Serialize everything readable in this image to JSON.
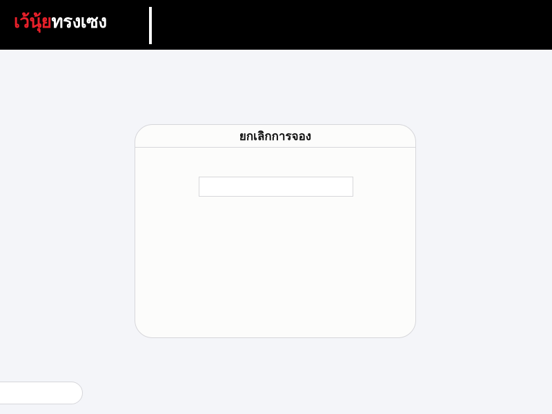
{
  "header": {
    "logo": {
      "red_part": "เว้นุ้ย",
      "white_part": "ทรงเซง"
    }
  },
  "card": {
    "title": "ยกเลิกการจอง",
    "input": {
      "value": "",
      "placeholder": ""
    }
  },
  "colors": {
    "header_bg": "#000000",
    "logo_red": "#e8202a",
    "logo_white": "#ffffff",
    "page_bg": "#f4f5f9"
  }
}
